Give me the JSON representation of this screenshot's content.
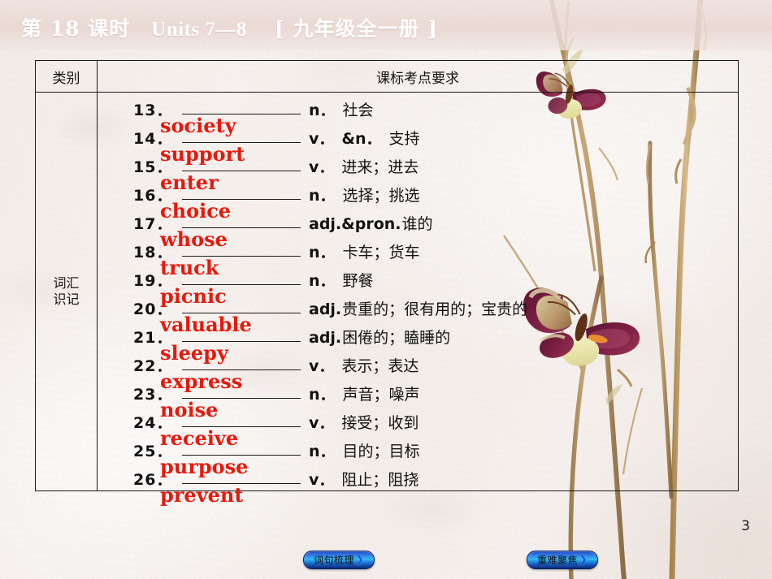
{
  "slide": {
    "title_lesson": "第 18 课时",
    "title_units": "Units 7—8",
    "title_grade": "[ 九年级全一册 ]",
    "page_number": "3",
    "accent_red": "#e8180c",
    "accent_blue": "#1554d8",
    "paper_color": "#f5efec"
  },
  "table": {
    "header": {
      "category": "类别",
      "requirement": "课标考点要求"
    },
    "category_label_line1": "词汇",
    "category_label_line2": "识记",
    "rows": [
      {
        "num": "13．",
        "pos": "n．",
        "meaning": "社会",
        "answer": "society"
      },
      {
        "num": "14．",
        "pos": "v．",
        "pos2": "&n．",
        "meaning": "支持",
        "answer": "support"
      },
      {
        "num": "15．",
        "pos": "v．",
        "meaning": "进来；进去",
        "answer": "enter"
      },
      {
        "num": "16．",
        "pos": "n．",
        "meaning": "选择；挑选",
        "answer": "choice"
      },
      {
        "num": "17．",
        "pos": "adj.&pron.",
        "meaning": "谁的",
        "answer": "whose"
      },
      {
        "num": "18．",
        "pos": "n．",
        "meaning": "卡车；货车",
        "answer": "truck"
      },
      {
        "num": "19．",
        "pos": "n．",
        "meaning": "野餐",
        "answer": "picnic"
      },
      {
        "num": "20．",
        "pos": "adj.",
        "meaning": "贵重的；很有用的；宝贵的",
        "answer": "valuable"
      },
      {
        "num": "21．",
        "pos": "adj.",
        "meaning": "困倦的；瞌睡的",
        "answer": "sleepy"
      },
      {
        "num": "22．",
        "pos": "v．",
        "meaning": "表示；表达",
        "answer": "express"
      },
      {
        "num": "23．",
        "pos": "n．",
        "meaning": "声音；噪声",
        "answer": "noise"
      },
      {
        "num": "24．",
        "pos": "v．",
        "meaning": "接受；收到",
        "answer": "receive"
      },
      {
        "num": "25．",
        "pos": "n．",
        "meaning": "目的；目标",
        "answer": "purpose"
      },
      {
        "num": "26．",
        "pos": "v．",
        "meaning": "阻止；阻挠",
        "answer": "prevent"
      }
    ]
  },
  "nav": {
    "left_button": "词句梳理",
    "left_arrow": "❯",
    "right_button": "重难聚焦",
    "right_arrow": "❯"
  }
}
